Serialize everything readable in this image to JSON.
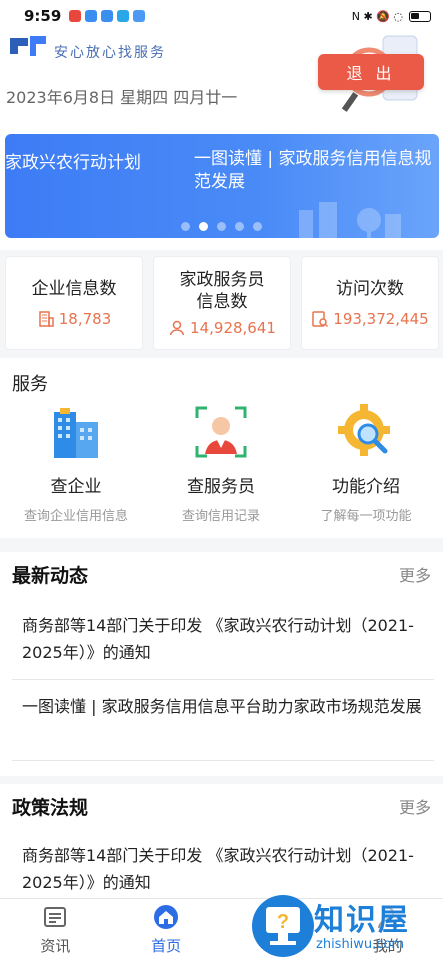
{
  "status_bar": {
    "time": "9:59",
    "right_indicators": "N ✱ 🔕 ◌"
  },
  "header": {
    "slogan": "安心放心找服务",
    "date": "2023年6月8日 星期四 四月廿一",
    "logout_label": "退 出"
  },
  "banner": {
    "title_left": "家政兴农行动计划",
    "title_right": "一图读懂 | 家政服务信用信息规范发展",
    "page_count": 5,
    "active_page": 1
  },
  "stats": [
    {
      "label": "企业信息数",
      "value": "18,783",
      "icon": "building-icon"
    },
    {
      "label": "家政服务员信息数",
      "value": "14,928,641",
      "icon": "person-icon"
    },
    {
      "label": "访问次数",
      "value": "193,372,445",
      "icon": "document-search-icon"
    }
  ],
  "services": {
    "title": "服务",
    "items": [
      {
        "name": "查企业",
        "desc": "查询企业信用信息",
        "icon": "company-building-icon"
      },
      {
        "name": "查服务员",
        "desc": "查询信用记录",
        "icon": "face-scan-icon"
      },
      {
        "name": "功能介绍",
        "desc": "了解每一项功能",
        "icon": "gear-magnifier-icon"
      }
    ]
  },
  "news": {
    "title": "最新动态",
    "more": "更多",
    "items": [
      {
        "text": "商务部等14部门关于印发 《家政兴农行动计划（2021-2025年）》的通知"
      },
      {
        "text": "一图读懂 | 家政服务信用信息平台助力家政市场规范发展"
      }
    ]
  },
  "policy": {
    "title": "政策法规",
    "more": "更多",
    "items": [
      {
        "text": "商务部等14部门关于印发 《家政兴农行动计划（2021-2025年）》的通知"
      }
    ]
  },
  "bottom_nav": [
    {
      "label": "资讯",
      "icon": "news-icon",
      "active": false
    },
    {
      "label": "首页",
      "icon": "home-icon",
      "active": true
    },
    {
      "label": "",
      "icon": "help-icon",
      "active": false
    },
    {
      "label": "我的",
      "icon": "user-icon",
      "active": false
    }
  ],
  "watermark": {
    "text": "知识屋",
    "url": "zhishiwu.com"
  },
  "colors": {
    "primary": "#3d7cf5",
    "accent": "#e8734f",
    "logout": "#ea5a47",
    "active_nav": "#2c6de6"
  }
}
